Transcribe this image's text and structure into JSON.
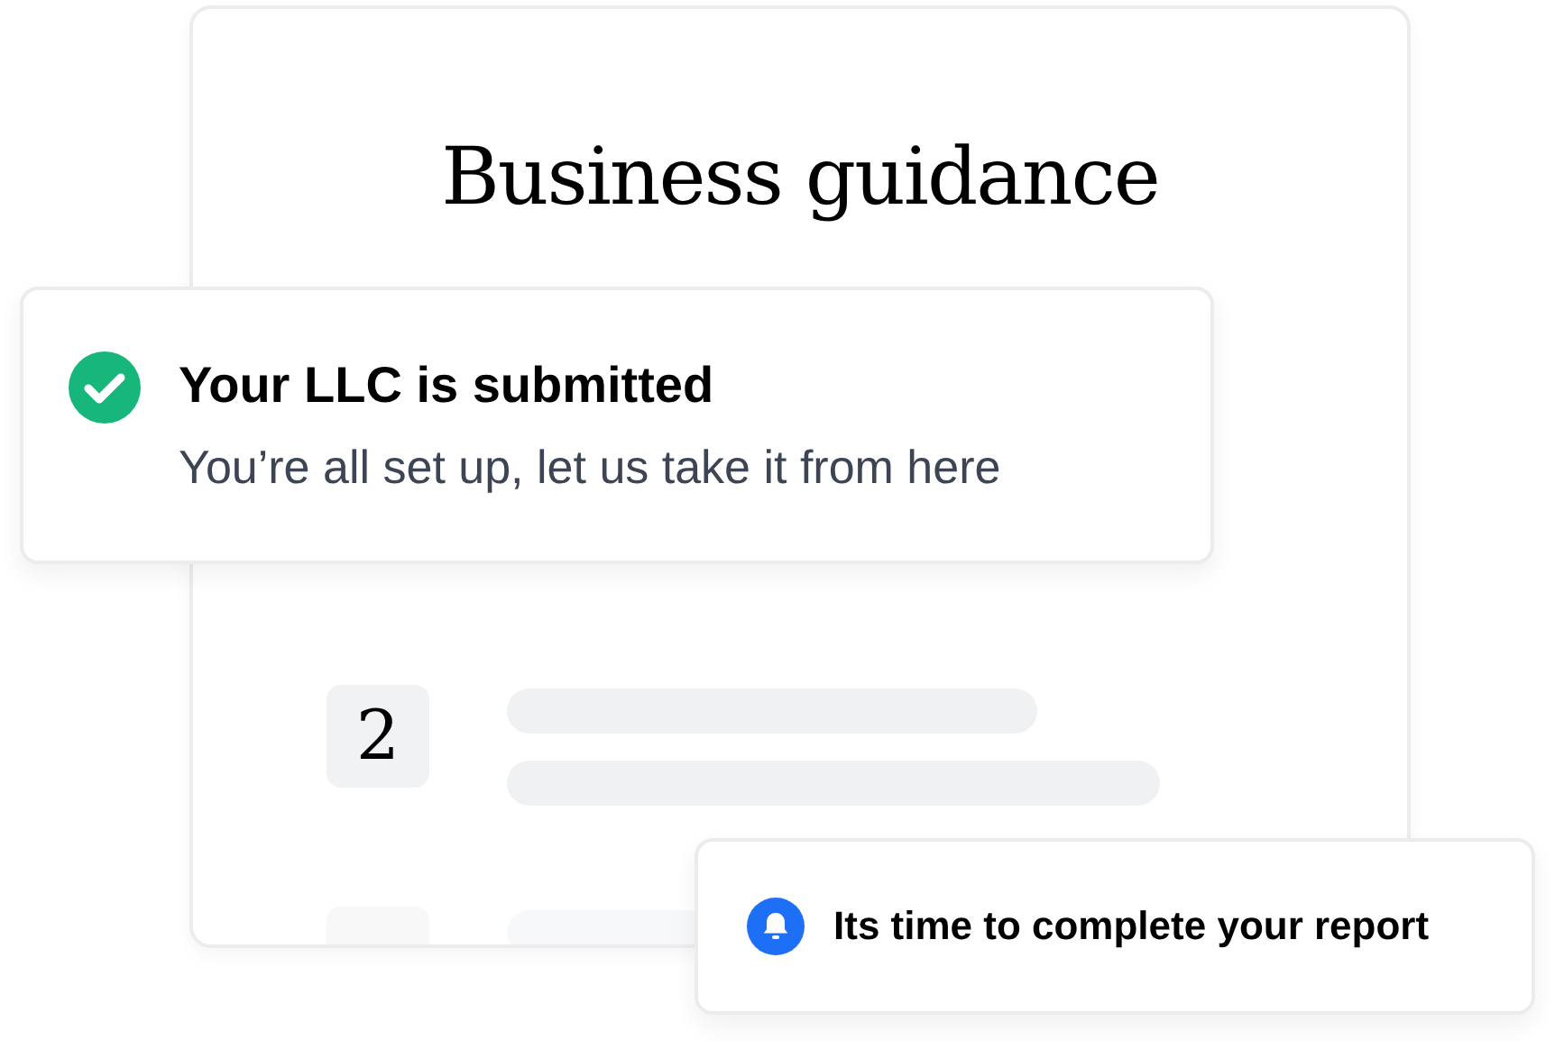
{
  "guide_card": {
    "title": "Business guidance",
    "steps": [
      {
        "number": "2"
      }
    ]
  },
  "notifications": [
    {
      "kind": "success",
      "title": "Your LLC is submitted",
      "message": "You’re all set up, let us take it from here"
    },
    {
      "kind": "reminder",
      "title": "Its time to complete your report"
    }
  ]
}
